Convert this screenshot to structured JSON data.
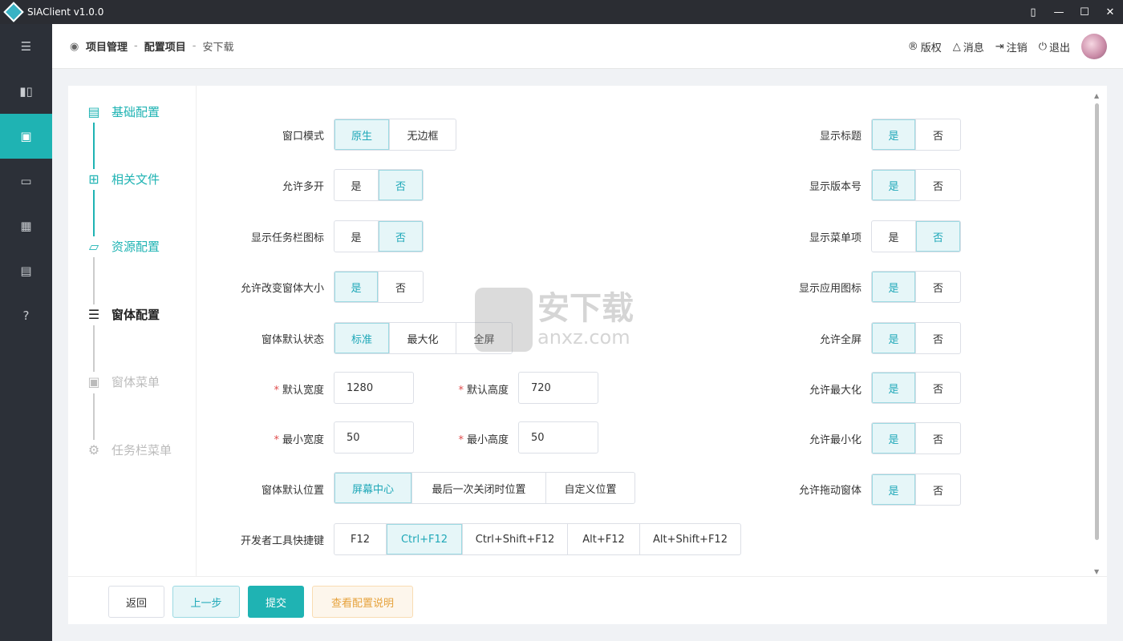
{
  "window": {
    "title": "SIAClient v1.0.0"
  },
  "header": {
    "breadcrumb": [
      "项目管理",
      "配置项目",
      "安下载"
    ],
    "links": [
      "版权",
      "消息",
      "注销",
      "退出"
    ]
  },
  "steps": [
    {
      "label": "基础配置",
      "icon": "doc-icon",
      "state": "done"
    },
    {
      "label": "相关文件",
      "icon": "file-add-icon",
      "state": "done"
    },
    {
      "label": "资源配置",
      "icon": "folder-icon",
      "state": "done"
    },
    {
      "label": "窗体配置",
      "icon": "window-icon",
      "state": "current"
    },
    {
      "label": "窗体菜单",
      "icon": "menu-icon",
      "state": "todo"
    },
    {
      "label": "任务栏菜单",
      "icon": "gear-icon",
      "state": "todo"
    }
  ],
  "form": {
    "window_mode": {
      "label": "窗口模式",
      "options": [
        "原生",
        "无边框"
      ],
      "selected": "原生"
    },
    "allow_multi": {
      "label": "允许多开",
      "options": [
        "是",
        "否"
      ],
      "selected": "否"
    },
    "taskbar_icon": {
      "label": "显示任务栏图标",
      "options": [
        "是",
        "否"
      ],
      "selected": "否"
    },
    "allow_resize": {
      "label": "允许改变窗体大小",
      "options": [
        "是",
        "否"
      ],
      "selected": "是"
    },
    "default_state": {
      "label": "窗体默认状态",
      "options": [
        "标准",
        "最大化",
        "全屏"
      ],
      "selected": "标准"
    },
    "default_width": {
      "label": "默认宽度",
      "value": "1280"
    },
    "default_height": {
      "label": "默认高度",
      "value": "720"
    },
    "min_width": {
      "label": "最小宽度",
      "value": "50"
    },
    "min_height": {
      "label": "最小高度",
      "value": "50"
    },
    "default_position": {
      "label": "窗体默认位置",
      "options": [
        "屏幕中心",
        "最后一次关闭时位置",
        "自定义位置"
      ],
      "selected": "屏幕中心"
    },
    "devtools_key": {
      "label": "开发者工具快捷键",
      "options": [
        "F12",
        "Ctrl+F12",
        "Ctrl+Shift+F12",
        "Alt+F12",
        "Alt+Shift+F12"
      ],
      "selected": "Ctrl+F12"
    },
    "show_title": {
      "label": "显示标题",
      "options": [
        "是",
        "否"
      ],
      "selected": "是"
    },
    "show_version": {
      "label": "显示版本号",
      "options": [
        "是",
        "否"
      ],
      "selected": "是"
    },
    "show_menu": {
      "label": "显示菜单项",
      "options": [
        "是",
        "否"
      ],
      "selected": "否"
    },
    "show_app_icon": {
      "label": "显示应用图标",
      "options": [
        "是",
        "否"
      ],
      "selected": "是"
    },
    "allow_fullscreen": {
      "label": "允许全屏",
      "options": [
        "是",
        "否"
      ],
      "selected": "是"
    },
    "allow_maximize": {
      "label": "允许最大化",
      "options": [
        "是",
        "否"
      ],
      "selected": "是"
    },
    "allow_minimize": {
      "label": "允许最小化",
      "options": [
        "是",
        "否"
      ],
      "selected": "是"
    },
    "allow_drag": {
      "label": "允许拖动窗体",
      "options": [
        "是",
        "否"
      ],
      "selected": "是"
    }
  },
  "footer": {
    "back": "返回",
    "prev": "上一步",
    "submit": "提交",
    "help": "查看配置说明"
  },
  "watermark": {
    "title": "安下载",
    "domain": "anxz.com"
  },
  "colors": {
    "accent": "#1fb3b3",
    "sidebar": "#2c3038",
    "titlebar": "#2b2d33"
  }
}
